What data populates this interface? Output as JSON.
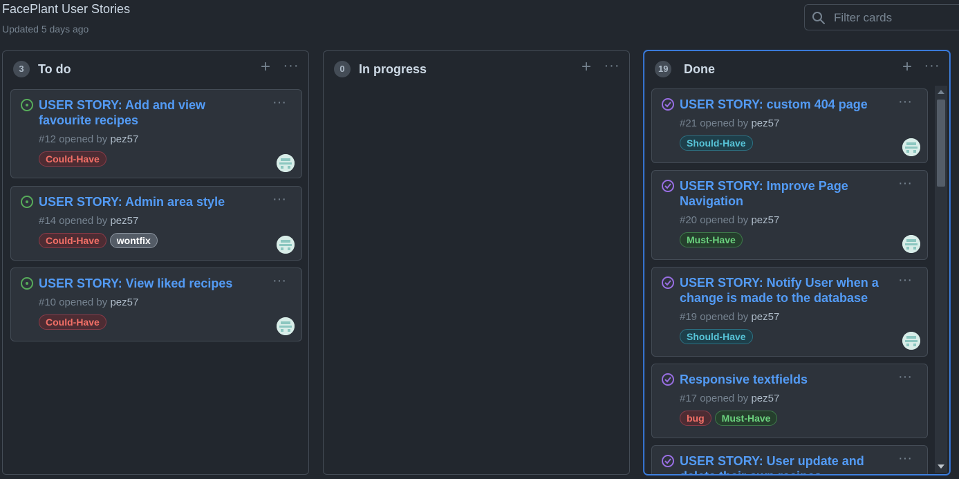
{
  "project": {
    "title": "FacePlant User Stories",
    "updated": "Updated 5 days ago",
    "filter_placeholder": "Filter cards"
  },
  "columns": [
    {
      "count": "3",
      "name": "To do",
      "cards": [
        {
          "title": "USER STORY: Add and view favourite recipes",
          "number": "#12",
          "opened_by": "opened by",
          "author": "pez57",
          "labels": [
            "Could-Have"
          ],
          "status": "open"
        },
        {
          "title": "USER STORY: Admin area style",
          "number": "#14",
          "opened_by": "opened by",
          "author": "pez57",
          "labels": [
            "Could-Have",
            "wontfix"
          ],
          "status": "open"
        },
        {
          "title": "USER STORY: View liked recipes",
          "number": "#10",
          "opened_by": "opened by",
          "author": "pez57",
          "labels": [
            "Could-Have"
          ],
          "status": "open"
        }
      ]
    },
    {
      "count": "0",
      "name": "In progress",
      "cards": []
    },
    {
      "count": "19",
      "name": "Done",
      "cards": [
        {
          "title": "USER STORY: custom 404 page",
          "number": "#21",
          "opened_by": "opened by",
          "author": "pez57",
          "labels": [
            "Should-Have"
          ],
          "status": "closed"
        },
        {
          "title": "USER STORY: Improve Page Navigation",
          "number": "#20",
          "opened_by": "opened by",
          "author": "pez57",
          "labels": [
            "Must-Have"
          ],
          "status": "closed"
        },
        {
          "title": "USER STORY: Notify User when a change is made to the database",
          "number": "#19",
          "opened_by": "opened by",
          "author": "pez57",
          "labels": [
            "Should-Have"
          ],
          "status": "closed"
        },
        {
          "title": "Responsive textfields",
          "number": "#17",
          "opened_by": "opened by",
          "author": "pez57",
          "labels": [
            "bug",
            "Must-Have"
          ],
          "status": "closed"
        },
        {
          "title": "USER STORY: User update and delete their own recipes",
          "status": "closed"
        }
      ]
    }
  ],
  "icons": {
    "open_issue": "issue-open-icon",
    "closed_issue": "issue-closed-icon",
    "add": "plus-icon",
    "more": "kebab-icon",
    "search": "search-icon"
  },
  "colors": {
    "background": "#22272e",
    "card": "#2d333b",
    "accent_blue": "#539bf5",
    "open_green": "#57ab5a",
    "closed_purple": "#986ee2"
  }
}
